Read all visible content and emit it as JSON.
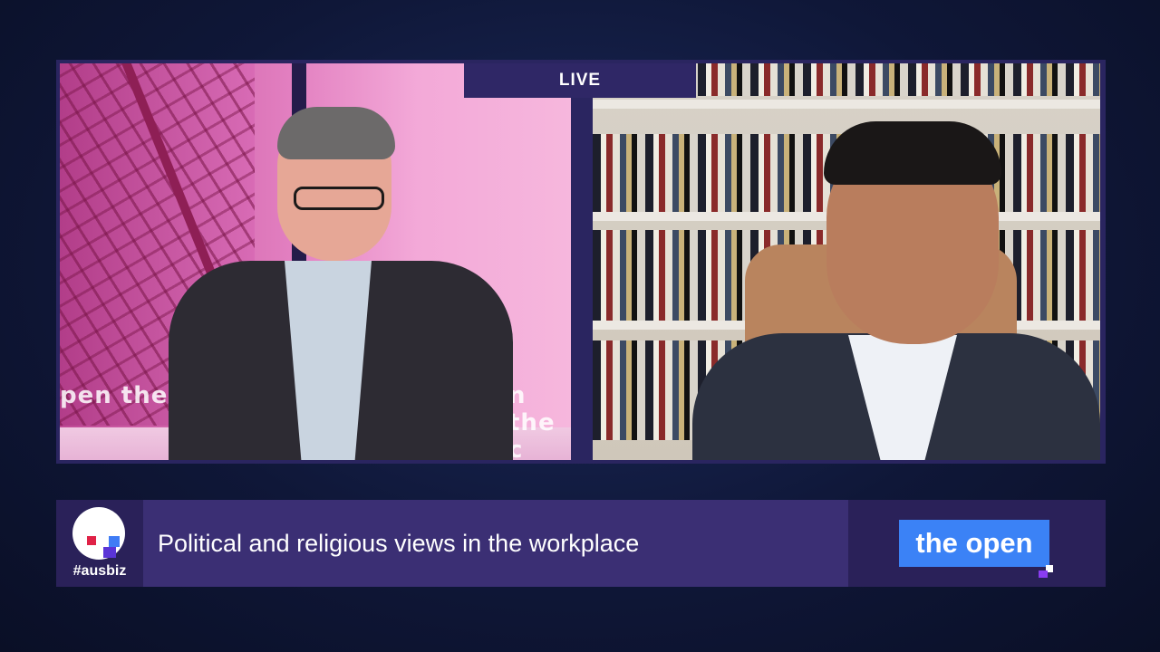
{
  "broadcast": {
    "live_label": "LIVE",
    "hashtag": "#ausbiz",
    "headline": "Political and religious views in the workplace",
    "show_name": "the open",
    "studio_screen_text_left": "pen the c",
    "studio_screen_text_right": "n the c"
  },
  "colors": {
    "background": "#0f1738",
    "frame": "#2a2560",
    "lower_third": "#3b2f74",
    "brand_dark": "#2a2159",
    "show_logo": "#3b82f6"
  },
  "icons": {
    "brand_logo": "ausbiz-logo-icon",
    "show_logo": "the-open-logo-icon"
  }
}
